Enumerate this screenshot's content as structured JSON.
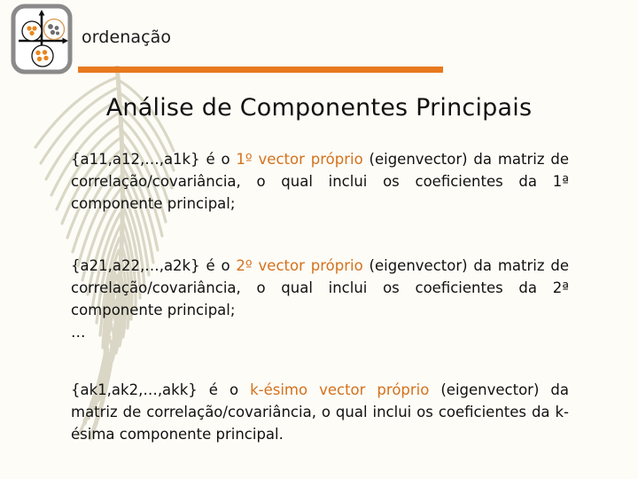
{
  "colors": {
    "background": "#fdfcf7",
    "accent_orange": "#e8791e",
    "accent_text_orange": "#d4711c",
    "body_text": "#111111",
    "logo_frame_gray": "#8a8a8a",
    "watermark_beige": "#d9d6c4"
  },
  "header": {
    "logo_icon": "ordination-scatter-icon",
    "title": "ordenação",
    "rule_icon": "horizontal-rule-divider"
  },
  "main": {
    "title": "Análise de Componentes Principais",
    "paragraphs": [
      {
        "id": "first-eigenvector",
        "prefix": "{a11,a12,…,a1k} é o ",
        "accent": "1º vector próprio",
        "suffix": " (eigenvector) da matriz de correlação/covariância, o qual inclui os coeficientes da 1ª componente principal;"
      },
      {
        "id": "second-eigenvector",
        "prefix": "{a21,a22,…,a2k} é o ",
        "accent": "2º vector próprio",
        "suffix": " (eigenvector) da matriz de correlação/covariância, o qual inclui os coeficientes da 2ª componente principal;"
      },
      {
        "id": "kth-eigenvector",
        "prefix": "{ak1,ak2,…,akk} é o ",
        "accent": "k-ésimo vector próprio",
        "suffix": " (eigenvector) da matriz de correlação/covariância, o qual inclui os coeficientes da k-ésima componente principal."
      }
    ],
    "ellipsis": "…"
  }
}
